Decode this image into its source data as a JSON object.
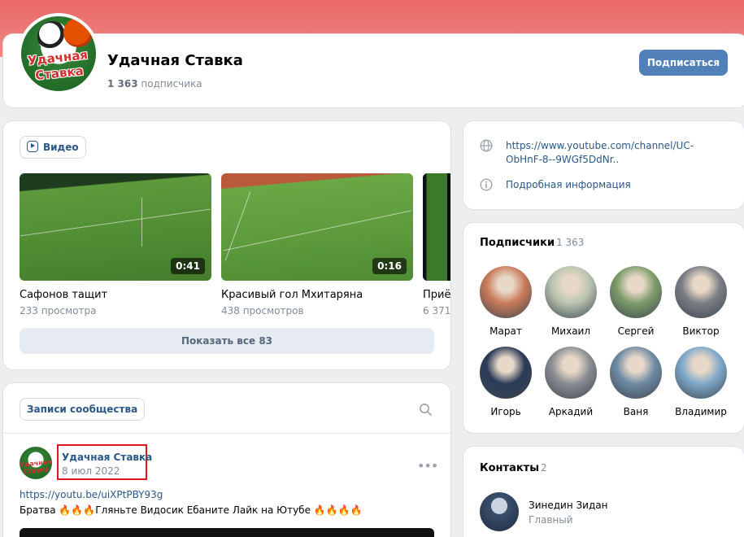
{
  "header": {
    "logo_text": "Удачная Ставка",
    "name": "Удачная Ставка",
    "subscribers_count": "1 363",
    "subscribers_word": "подписчика",
    "subscribe_label": "Подписаться"
  },
  "videos": {
    "tab_label": "Видео",
    "items": [
      {
        "title": "Сафонов тащит",
        "views": "233 просмотра",
        "duration": "0:41"
      },
      {
        "title": "Красивый гол Мхитаряна",
        "views": "438 просмотров",
        "duration": "0:16"
      },
      {
        "title": "Приё",
        "views": "6 371",
        "duration": ""
      }
    ],
    "show_all_label": "Показать все 83"
  },
  "posts": {
    "tab_label": "Записи сообщества",
    "post": {
      "author": "Удачная Ставка",
      "date": "8 июл 2022",
      "link": "https://youtu.be/uiXPtPBY93g",
      "text": "Братва 🔥🔥🔥Гляньте Видосик Ебаните Лайк на Ютубе 🔥🔥🔥🔥"
    }
  },
  "info": {
    "website": "https://www.youtube.com/channel/UC-ObHnF-8--9WGf5DdNr..",
    "details_label": "Подробная информация"
  },
  "subscribers": {
    "title": "Подписчики",
    "count": "1 363",
    "members": [
      {
        "name": "Марат",
        "color": "#c97b5a"
      },
      {
        "name": "Михаил",
        "color": "#b9c4b0"
      },
      {
        "name": "Сергей",
        "color": "#7d9c6a"
      },
      {
        "name": "Виктор",
        "color": "#7a7e84"
      },
      {
        "name": "Игорь",
        "color": "#2b3b57"
      },
      {
        "name": "Аркадий",
        "color": "#8a8d92"
      },
      {
        "name": "Ваня",
        "color": "#6e8aa3"
      },
      {
        "name": "Владимир",
        "color": "#7fa8c9"
      }
    ]
  },
  "contacts": {
    "title": "Контакты",
    "count": "2",
    "items": [
      {
        "name": "Зинедин Зидан",
        "role": "Главный"
      }
    ]
  }
}
